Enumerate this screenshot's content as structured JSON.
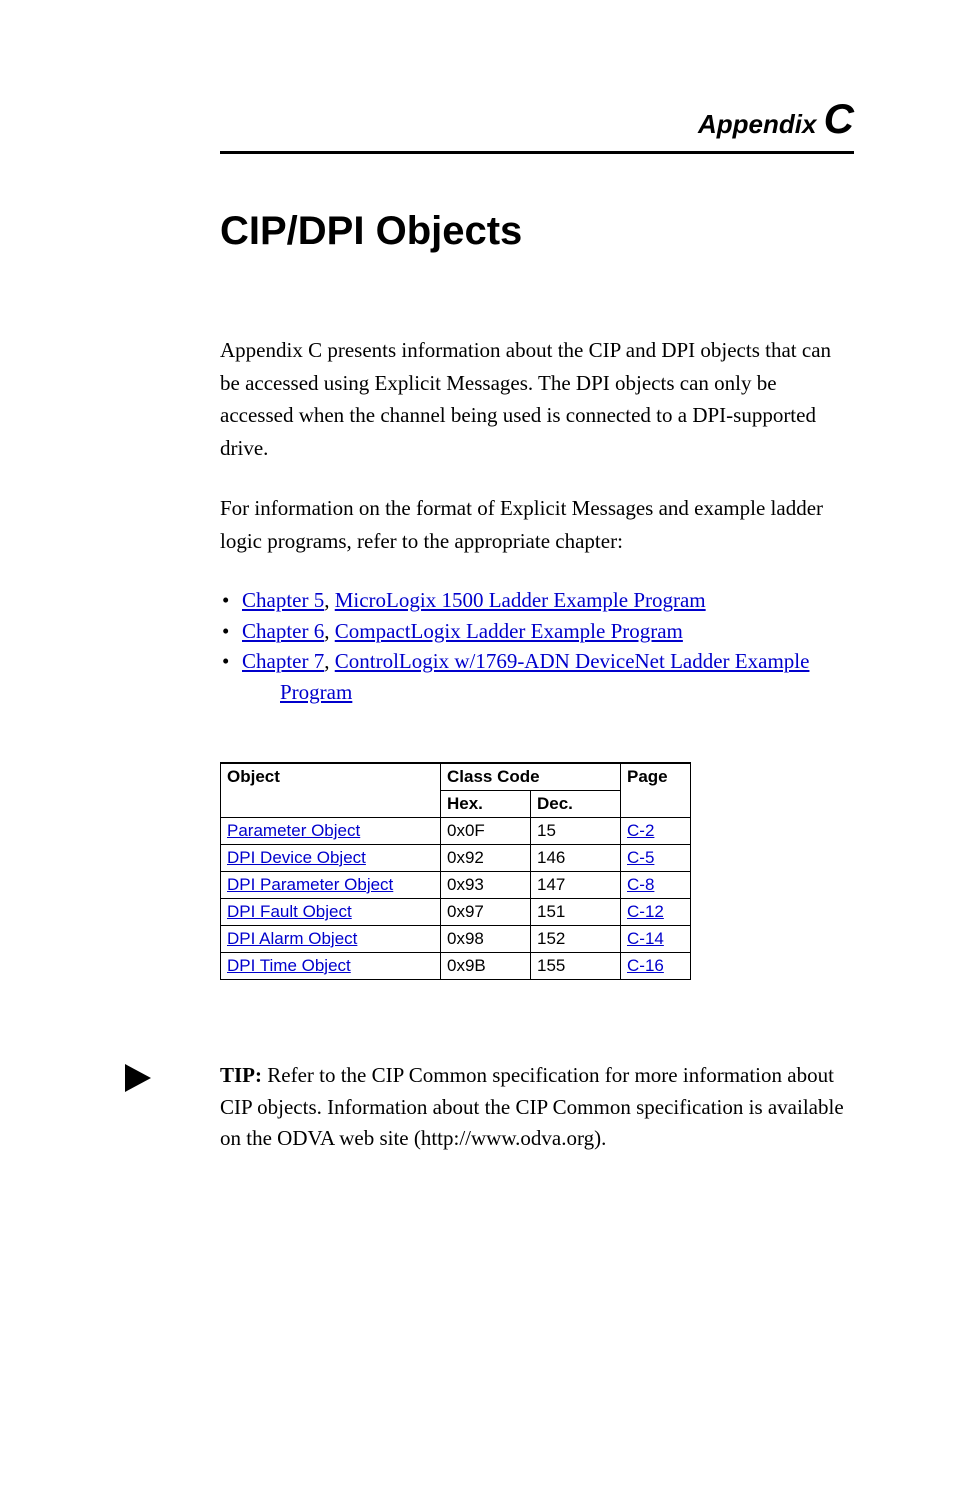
{
  "header": {
    "appendix_label": "Appendix",
    "appendix_letter": "C"
  },
  "title": "CIP/DPI Objects",
  "paragraphs": {
    "intro1": "Appendix C presents information about the CIP and DPI objects that can be accessed using Explicit Messages. The DPI objects can only be accessed when the channel being used is connected to a DPI-supported drive.",
    "intro2": "For information on the format of Explicit Messages and example ladder logic programs, refer to the appropriate chapter:"
  },
  "chapter_links": [
    {
      "chapter": "Chapter 5",
      "sep": ", ",
      "title": "MicroLogix 1500 Ladder Example Program"
    },
    {
      "chapter": "Chapter 6",
      "sep": ", ",
      "title": "CompactLogix Ladder Example Program"
    },
    {
      "chapter": "Chapter 7",
      "sep": ", ",
      "title_line1": "ControlLogix w/1769-ADN DeviceNet Ladder Example",
      "title_line2": "Program"
    }
  ],
  "table": {
    "headers": {
      "object": "Object",
      "classcode": "Class Code",
      "hex": "Hex.",
      "dec": "Dec.",
      "page": "Page"
    },
    "rows": [
      {
        "object": "Parameter Object",
        "hex": "0x0F",
        "dec": "15",
        "page": "C-2"
      },
      {
        "object": "DPI Device Object",
        "hex": "0x92",
        "dec": "146",
        "page": "C-5"
      },
      {
        "object": "DPI Parameter Object",
        "hex": "0x93",
        "dec": "147",
        "page": "C-8"
      },
      {
        "object": "DPI Fault Object",
        "hex": "0x97",
        "dec": "151",
        "page": "C-12"
      },
      {
        "object": "DPI Alarm Object",
        "hex": "0x98",
        "dec": "152",
        "page": "C-14"
      },
      {
        "object": "DPI Time Object",
        "hex": "0x9B",
        "dec": "155",
        "page": "C-16"
      }
    ]
  },
  "tip": {
    "label": "TIP:",
    "text": "  Refer to the CIP Common specification for more information about CIP objects. Information about the CIP Common specification is available on the ODVA web site (http://www.odva.org)."
  }
}
